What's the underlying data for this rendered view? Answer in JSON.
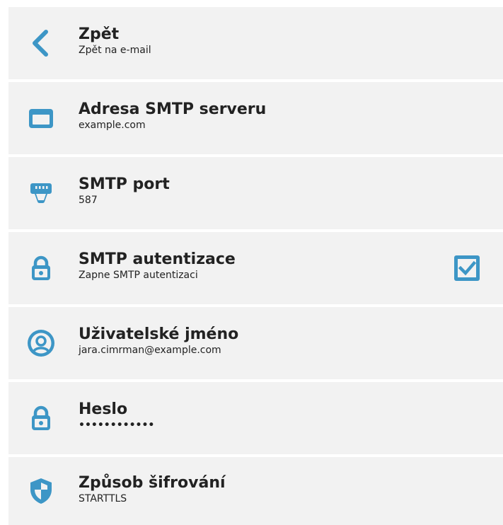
{
  "colors": {
    "accent": "#3d96c6",
    "row_bg": "#f2f2f2",
    "text": "#222222"
  },
  "items": [
    {
      "icon": "chevron-left-icon",
      "title": "Zpět",
      "subtitle": "Zpět na e-mail"
    },
    {
      "icon": "window-icon",
      "title": "Adresa SMTP serveru",
      "subtitle": "example.com"
    },
    {
      "icon": "ethernet-port-icon",
      "title": "SMTP port",
      "subtitle": "587"
    },
    {
      "icon": "lock-icon",
      "title": "SMTP autentizace",
      "subtitle": "Zapne SMTP autentizaci",
      "checked": true
    },
    {
      "icon": "user-circle-icon",
      "title": "Uživatelské jméno",
      "subtitle": "jara.cimrman@example.com"
    },
    {
      "icon": "lock-icon",
      "title": "Heslo",
      "subtitle": "••••••••••••"
    },
    {
      "icon": "shield-icon",
      "title": "Způsob šifrování",
      "subtitle": "STARTTLS"
    }
  ]
}
